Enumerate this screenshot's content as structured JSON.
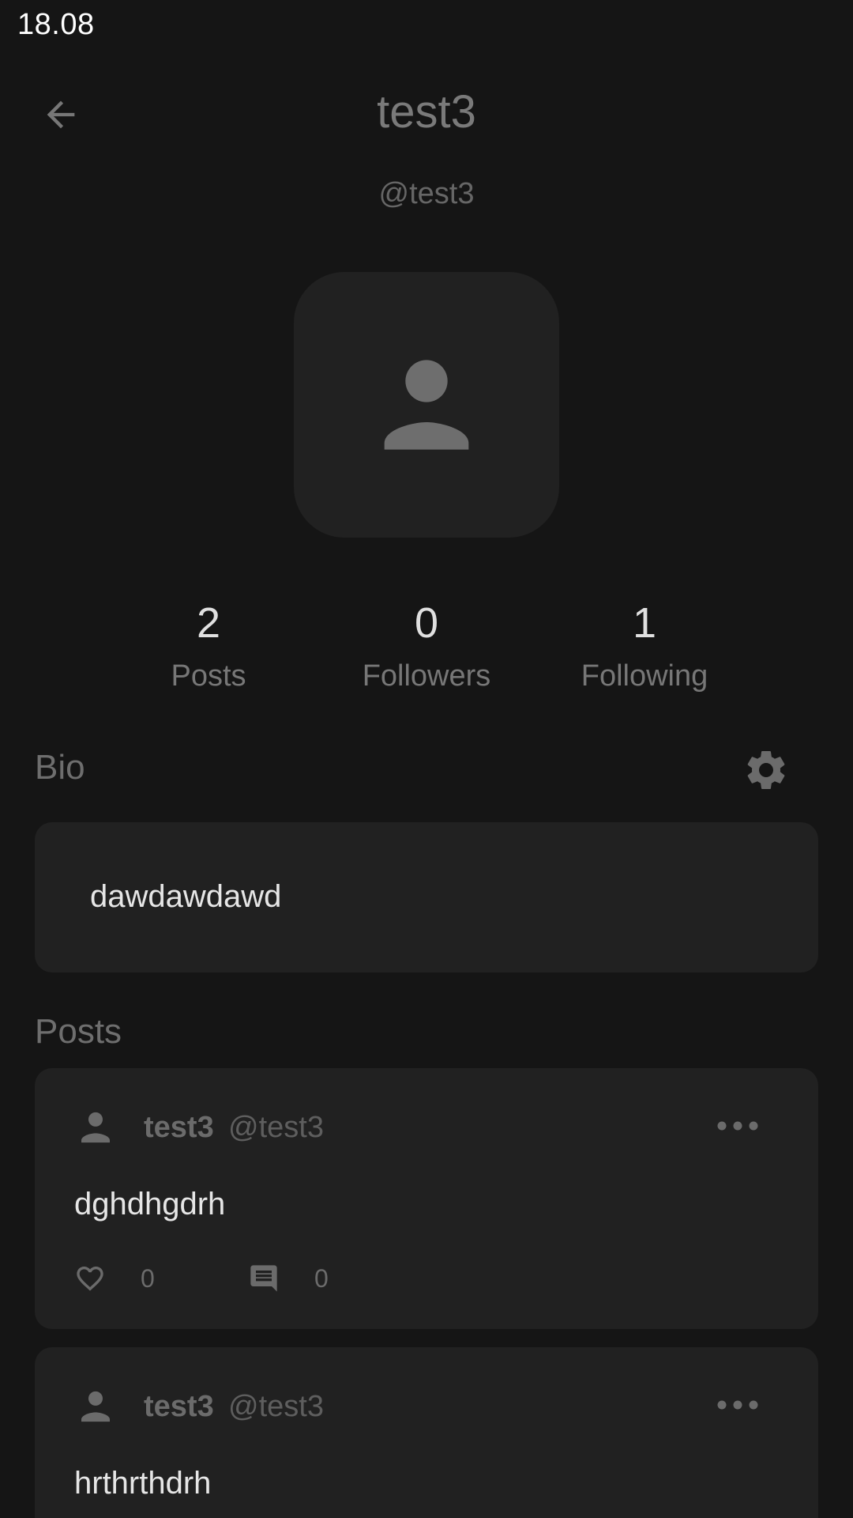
{
  "status_bar": {
    "time": "18.08"
  },
  "header": {
    "title": "test3",
    "handle": "@test3",
    "back_icon": "arrow-left-icon"
  },
  "avatar": {
    "icon": "person-icon"
  },
  "stats": [
    {
      "value": "2",
      "label": "Posts"
    },
    {
      "value": "0",
      "label": "Followers"
    },
    {
      "value": "1",
      "label": "Following"
    }
  ],
  "bio": {
    "title": "Bio",
    "text": "dawdawdawd",
    "settings_icon": "gear-icon"
  },
  "posts_section": {
    "title": "Posts"
  },
  "posts": [
    {
      "author": "test3",
      "handle": "@test3",
      "text": "dghdhgdrh",
      "likes": "0",
      "comments": "0"
    },
    {
      "author": "test3",
      "handle": "@test3",
      "text": "hrthrthdrh"
    }
  ],
  "colors": {
    "background": "#151515",
    "card": "#212121",
    "muted_text": "#6e6e6e",
    "primary_text": "#e6e6e6"
  }
}
